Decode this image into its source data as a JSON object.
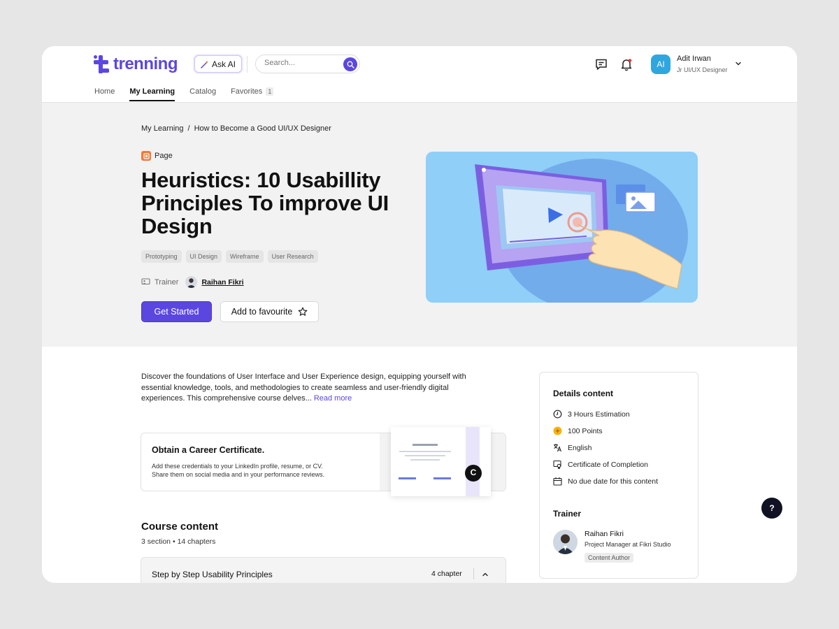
{
  "brand": {
    "name": "trenning",
    "accent": "#5b47e0"
  },
  "header": {
    "ask_ai_label": "Ask AI",
    "search_placeholder": "Search...",
    "user": {
      "initials": "AI",
      "name": "Adit Irwan",
      "role": "Jr UI/UX Designer"
    },
    "icons": [
      "chat-icon",
      "bell-icon",
      "chevron-down-icon",
      "search-icon"
    ]
  },
  "nav": {
    "items": [
      {
        "label": "Home"
      },
      {
        "label": "My Learning",
        "active": true
      },
      {
        "label": "Catalog"
      },
      {
        "label": "Favorites",
        "badge": "1"
      }
    ]
  },
  "breadcrumb": {
    "root": "My Learning",
    "separator": "/",
    "current": "How to Become a Good UI/UX Designer"
  },
  "hero": {
    "type_label": "Page",
    "title": "Heuristics: 10 Usabillity Principles To improve UI Design",
    "tags": [
      "Prototyping",
      "UI Design",
      "Wireframe",
      "User Research"
    ],
    "trainer_label": "Trainer",
    "trainer_name": "Raihan Fikri",
    "primary_button": "Get Started",
    "secondary_button": "Add to favourite"
  },
  "description": {
    "text": "Discover the foundations of User Interface and User Experience design, equipping yourself with essential knowledge, tools, and methodologies to create seamless and user-friendly digital experiences. This comprehensive course delves...",
    "read_more": "Read more"
  },
  "certificate": {
    "title": "Obtain a Career Certificate.",
    "line1": "Add these credentials to your LinkedIn profile, resume, or CV.",
    "line2": "Share them on social media and in your performance reviews.",
    "seal_letter": "C"
  },
  "course_content": {
    "title": "Course content",
    "sections_count": "3 section",
    "bullet": "•",
    "chapters_count": "14 chapters",
    "sections": [
      {
        "title": "Step by Step Usability Principles",
        "chapters": "4 chapter"
      }
    ]
  },
  "details": {
    "title": "Details content",
    "items": [
      {
        "icon": "clock-icon",
        "label": "3 Hours Estimation"
      },
      {
        "icon": "points-icon",
        "label": "100 Points"
      },
      {
        "icon": "translate-icon",
        "label": "English"
      },
      {
        "icon": "certificate-icon",
        "label": "Certificate of Completion"
      },
      {
        "icon": "calendar-icon",
        "label": "No due date for this content"
      }
    ],
    "trainer_heading": "Trainer",
    "trainer": {
      "name": "Raihan Fikri",
      "job": "Project Manager at Fikri Studio",
      "badge": "Content Author"
    }
  },
  "help": {
    "label": "?"
  }
}
